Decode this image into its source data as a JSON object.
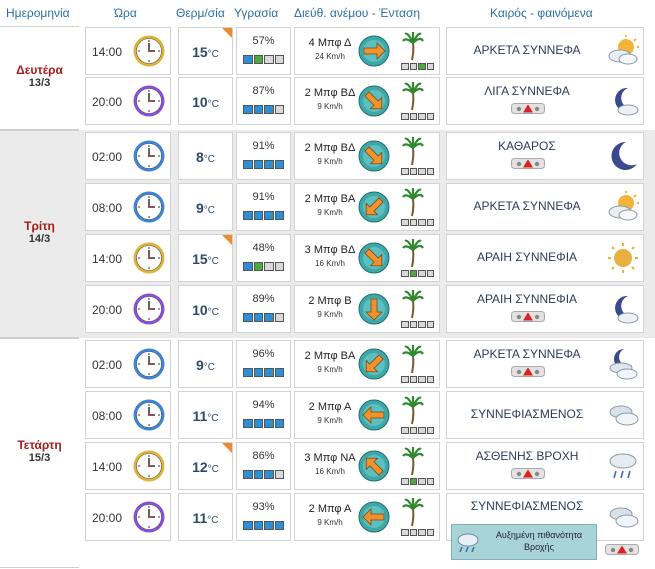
{
  "headers": {
    "date": "Ημερομηνία",
    "time": "Ώρα",
    "temp": "Θερμ/σία",
    "humidity": "Υγρασία",
    "wind": "Διεύθ. ανέμου - Ένταση",
    "weather": "Καιρός - φαινόμενα"
  },
  "temp_unit": "°C",
  "speed_unit": "Km/h",
  "note_text": "Αυξημένη πιθανότητα Βροχής",
  "days": [
    {
      "name": "Δευτέρα",
      "date": "13/3"
    },
    {
      "name": "Τρίτη",
      "date": "14/3"
    },
    {
      "name": "Τετάρτη",
      "date": "15/3"
    }
  ],
  "rows": [
    {
      "time": "14:00",
      "clock": "gold",
      "temp": "15",
      "temp_flag": true,
      "humidity": "57%",
      "hum_level": 2,
      "wind": "4 Μπφ Δ",
      "speed": "24",
      "wind_dir": 90,
      "wind_level": 2,
      "condition": "ΑΡΚΕΤΑ ΣΥΝΝΕΦΑ",
      "icon": "sun-clouds-icon",
      "warning": false,
      "note": false
    },
    {
      "time": "20:00",
      "clock": "purple",
      "temp": "10",
      "temp_flag": false,
      "humidity": "87%",
      "hum_level": 3,
      "wind": "2 Μπφ ΒΔ",
      "speed": "9",
      "wind_dir": 135,
      "wind_level": 0,
      "condition": "ΛΙΓΑ ΣΥΝΝΕΦΑ",
      "icon": "moon-cloud-icon",
      "warning": true,
      "note": false
    },
    {
      "time": "02:00",
      "clock": "blue",
      "temp": "8",
      "temp_flag": false,
      "humidity": "91%",
      "hum_level": 4,
      "wind": "2 Μπφ ΒΔ",
      "speed": "9",
      "wind_dir": 135,
      "wind_level": 0,
      "condition": "ΚΑΘΑΡΟΣ",
      "icon": "moon-icon",
      "warning": true,
      "note": false
    },
    {
      "time": "08:00",
      "clock": "blue",
      "temp": "9",
      "temp_flag": false,
      "humidity": "91%",
      "hum_level": 4,
      "wind": "2 Μπφ ΒΑ",
      "speed": "9",
      "wind_dir": 225,
      "wind_level": 0,
      "condition": "ΑΡΚΕΤΑ ΣΥΝΝΕΦΑ",
      "icon": "sun-clouds-icon",
      "warning": false,
      "note": false
    },
    {
      "time": "14:00",
      "clock": "gold",
      "temp": "15",
      "temp_flag": true,
      "humidity": "48%",
      "hum_level": 2,
      "wind": "3 Μπφ ΒΔ",
      "speed": "16",
      "wind_dir": 135,
      "wind_level": 1,
      "condition": "ΑΡΑΙΗ ΣΥΝΝΕΦΙΑ",
      "icon": "sun-icon",
      "warning": false,
      "note": false
    },
    {
      "time": "20:00",
      "clock": "purple",
      "temp": "10",
      "temp_flag": false,
      "humidity": "89%",
      "hum_level": 3,
      "wind": "2 Μπφ Β",
      "speed": "9",
      "wind_dir": 180,
      "wind_level": 0,
      "condition": "ΑΡΑΙΗ ΣΥΝΝΕΦΙΑ",
      "icon": "moon-cloud-icon",
      "warning": true,
      "note": false
    },
    {
      "time": "02:00",
      "clock": "blue",
      "temp": "9",
      "temp_flag": false,
      "humidity": "96%",
      "hum_level": 4,
      "wind": "2 Μπφ ΒΑ",
      "speed": "9",
      "wind_dir": 225,
      "wind_level": 0,
      "condition": "ΑΡΚΕΤΑ ΣΥΝΝΕΦΑ",
      "icon": "moon-clouds-icon",
      "warning": true,
      "note": false
    },
    {
      "time": "08:00",
      "clock": "blue",
      "temp": "11",
      "temp_flag": false,
      "humidity": "94%",
      "hum_level": 4,
      "wind": "2 Μπφ Α",
      "speed": "9",
      "wind_dir": 270,
      "wind_level": 0,
      "condition": "ΣΥΝΝΕΦΙΑΣΜΕΝΟΣ",
      "icon": "clouds-icon",
      "warning": false,
      "note": false
    },
    {
      "time": "14:00",
      "clock": "gold",
      "temp": "12",
      "temp_flag": true,
      "humidity": "86%",
      "hum_level": 3,
      "wind": "3 Μπφ ΝΑ",
      "speed": "16",
      "wind_dir": 315,
      "wind_level": 1,
      "condition": "ΑΣΘΕΝΗΣ ΒΡΟΧΗ",
      "icon": "rain-cloud-icon",
      "warning": true,
      "note": false
    },
    {
      "time": "20:00",
      "clock": "purple",
      "temp": "11",
      "temp_flag": false,
      "humidity": "93%",
      "hum_level": 4,
      "wind": "2 Μπφ Α",
      "speed": "9",
      "wind_dir": 270,
      "wind_level": 0,
      "condition": "ΣΥΝΝΕΦΙΑΣΜΕΝΟΣ",
      "icon": "clouds-icon",
      "warning": true,
      "note": true
    }
  ]
}
